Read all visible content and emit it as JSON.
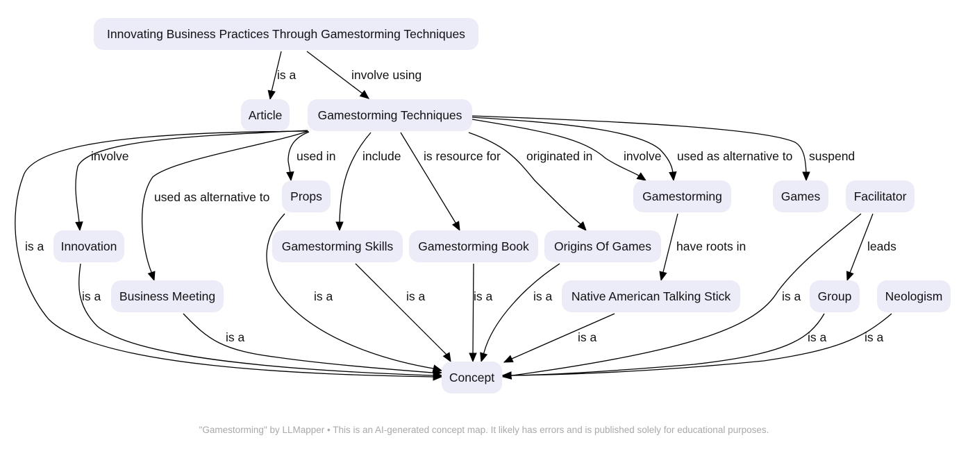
{
  "diagram": {
    "type": "concept-map",
    "nodes": [
      {
        "id": "title",
        "label": "Innovating Business Practices Through Gamestorming Techniques"
      },
      {
        "id": "article",
        "label": "Article"
      },
      {
        "id": "techniques",
        "label": "Gamestorming Techniques"
      },
      {
        "id": "props",
        "label": "Props"
      },
      {
        "id": "gamestorming",
        "label": "Gamestorming"
      },
      {
        "id": "games",
        "label": "Games"
      },
      {
        "id": "facilitator",
        "label": "Facilitator"
      },
      {
        "id": "innovation",
        "label": "Innovation"
      },
      {
        "id": "skills",
        "label": "Gamestorming Skills"
      },
      {
        "id": "book",
        "label": "Gamestorming Book"
      },
      {
        "id": "origins",
        "label": "Origins Of Games"
      },
      {
        "id": "meeting",
        "label": "Business Meeting"
      },
      {
        "id": "stick",
        "label": "Native American Talking Stick"
      },
      {
        "id": "group",
        "label": "Group"
      },
      {
        "id": "neologism",
        "label": "Neologism"
      },
      {
        "id": "concept",
        "label": "Concept"
      }
    ],
    "edges": [
      {
        "from": "title",
        "to": "article",
        "label": "is a"
      },
      {
        "from": "title",
        "to": "techniques",
        "label": "involve using"
      },
      {
        "from": "techniques",
        "to": "innovation",
        "label": "involve"
      },
      {
        "from": "techniques",
        "to": "meeting",
        "label": "used as alternative to"
      },
      {
        "from": "techniques",
        "to": "props",
        "label": "used in"
      },
      {
        "from": "techniques",
        "to": "skills",
        "label": "include"
      },
      {
        "from": "techniques",
        "to": "book",
        "label": "is resource for"
      },
      {
        "from": "techniques",
        "to": "origins",
        "label": "originated in"
      },
      {
        "from": "techniques",
        "to": "gamestorming",
        "label": "involve"
      },
      {
        "from": "techniques",
        "to": "gamestorming",
        "label": "used as alternative to"
      },
      {
        "from": "techniques",
        "to": "games",
        "label": "suspend"
      },
      {
        "from": "techniques",
        "to": "concept",
        "label": "is a"
      },
      {
        "from": "gamestorming",
        "to": "stick",
        "label": "have roots in"
      },
      {
        "from": "facilitator",
        "to": "group",
        "label": "leads"
      },
      {
        "from": "facilitator",
        "to": "concept",
        "label": "is a"
      },
      {
        "from": "innovation",
        "to": "concept",
        "label": "is a"
      },
      {
        "from": "meeting",
        "to": "concept",
        "label": "is a"
      },
      {
        "from": "props",
        "to": "concept",
        "label": "is a"
      },
      {
        "from": "skills",
        "to": "concept",
        "label": "is a"
      },
      {
        "from": "book",
        "to": "concept",
        "label": "is a"
      },
      {
        "from": "origins",
        "to": "concept",
        "label": "is a"
      },
      {
        "from": "stick",
        "to": "concept",
        "label": "is a"
      },
      {
        "from": "group",
        "to": "concept",
        "label": "is a"
      },
      {
        "from": "neologism",
        "to": "concept",
        "label": "is a"
      }
    ]
  },
  "footer": {
    "text": "\"Gamestorming\" by LLMapper • This is an AI-generated concept map. It likely has errors and is published solely for educational purposes."
  }
}
